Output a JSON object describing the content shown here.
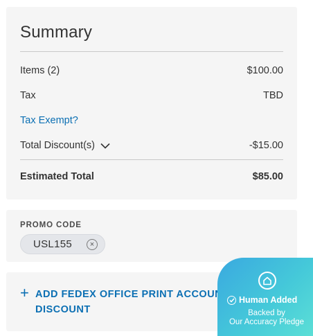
{
  "summary": {
    "title": "Summary",
    "items_label": "Items (2)",
    "items_value": "$100.00",
    "tax_label": "Tax",
    "tax_value": "TBD",
    "tax_exempt_link": "Tax Exempt?",
    "discount_label": "Total Discount(s)",
    "discount_value": "-$15.00",
    "total_label": "Estimated Total",
    "total_value": "$85.00"
  },
  "promo": {
    "label": "PROMO CODE",
    "code": "USL155",
    "remove_glyph": "×"
  },
  "print_account": {
    "plus_glyph": "+",
    "label": "ADD FEDEX OFFICE PRINT ACCOUNT FOR DISCOUNT"
  },
  "badge": {
    "title": "Human Added",
    "line1": "Backed by",
    "line2": "Our Accuracy Pledge",
    "icon": "house-icon",
    "check_icon": "check-circle-icon"
  },
  "colors": {
    "link": "#0b6fb3",
    "card_bg": "#f5f5f5",
    "badge_start": "#3aa9e0",
    "badge_end": "#5de0d6"
  }
}
